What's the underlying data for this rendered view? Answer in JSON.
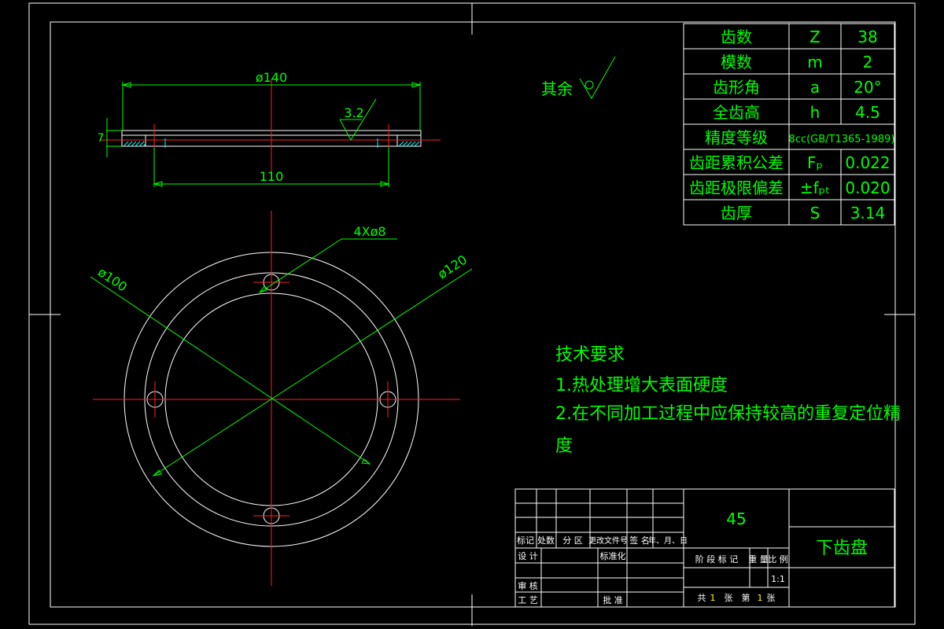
{
  "part": {
    "material": "45",
    "name": "下齿盘"
  },
  "gear_params": [
    {
      "name": "齿数",
      "symbol": "Z",
      "value": "38"
    },
    {
      "name": "模数",
      "symbol": "m",
      "value": "2"
    },
    {
      "name": "齿形角",
      "symbol": "a",
      "value": "20°"
    },
    {
      "name": "全齿高",
      "symbol": "h",
      "value": "4.5"
    },
    {
      "name": "精度等级",
      "symbol": "8cc(GB/T1365-1989)",
      "value": ""
    },
    {
      "name": "齿距累积公差",
      "symbol": "Fₚ",
      "value": "0.022"
    },
    {
      "name": "齿距极限偏差",
      "symbol": "±fₚₜ",
      "value": "0.020"
    },
    {
      "name": "齿厚",
      "symbol": "S",
      "value": "3.14"
    }
  ],
  "surface_finish": {
    "label": "其余",
    "local_value": "3.2"
  },
  "dimensions": {
    "top_outer_dia": "ø140",
    "top_inner": "110",
    "thickness": "7",
    "holes": "4Xø8",
    "dia_100": "ø100",
    "dia_120": "ø120"
  },
  "tech_requirements": {
    "title": "技术要求",
    "items": [
      "1.热处理增大表面硬度",
      "2.在不同加工过程中应保持较高的重复定位精",
      "度"
    ]
  },
  "title_block": {
    "headers": [
      "标记",
      "处数",
      "分 区",
      "更改文件号",
      "签 名",
      "年、月、日"
    ],
    "design": "设 计",
    "standardize": "标准化",
    "review": "审 核",
    "process": "工 艺",
    "approve": "批 准",
    "stage_mark": "阶 段 标 记",
    "weight": "重 量",
    "scale_label": "比 例",
    "scale_value": "1:1",
    "total_label": "共",
    "total_num": "1",
    "sheet_unit": "张",
    "sheet_label": "第",
    "sheet_num": "1",
    "sheet_unit2": "张"
  }
}
